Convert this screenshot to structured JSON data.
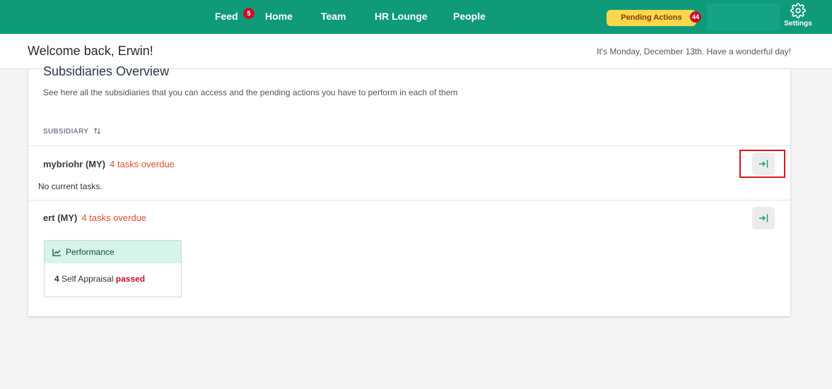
{
  "nav": {
    "items": [
      "Feed",
      "Home",
      "Team",
      "HR Lounge",
      "People"
    ],
    "feed_badge": "5",
    "pending_label": "Pending Actions",
    "pending_badge": "44",
    "settings_label": "Settings"
  },
  "welcome": {
    "title": "Welcome back, Erwin!",
    "date_text": "It's Monday, December 13th. Have a wonderful day!"
  },
  "overview": {
    "title": "Subsidiaries Overview",
    "subtitle": "See here all the subsidiaries that you can access and the pending actions you have to perform in each of them",
    "column_header": "SUBSIDIARY",
    "rows": [
      {
        "name": "mybriohr (MY)",
        "overdue": "4 tasks overdue",
        "empty_text": "No current tasks."
      },
      {
        "name": "ert (MY)",
        "overdue": "4 tasks overdue",
        "task_card": {
          "title": "Performance",
          "count": "4",
          "text": "Self Appraisal",
          "status": "passed"
        }
      }
    ]
  },
  "colors": {
    "topbar": "#0f9b7a",
    "pending": "#f8d74a",
    "badge": "#c8102e",
    "overdue": "#e04e2f",
    "highlight": "#d9171a"
  }
}
